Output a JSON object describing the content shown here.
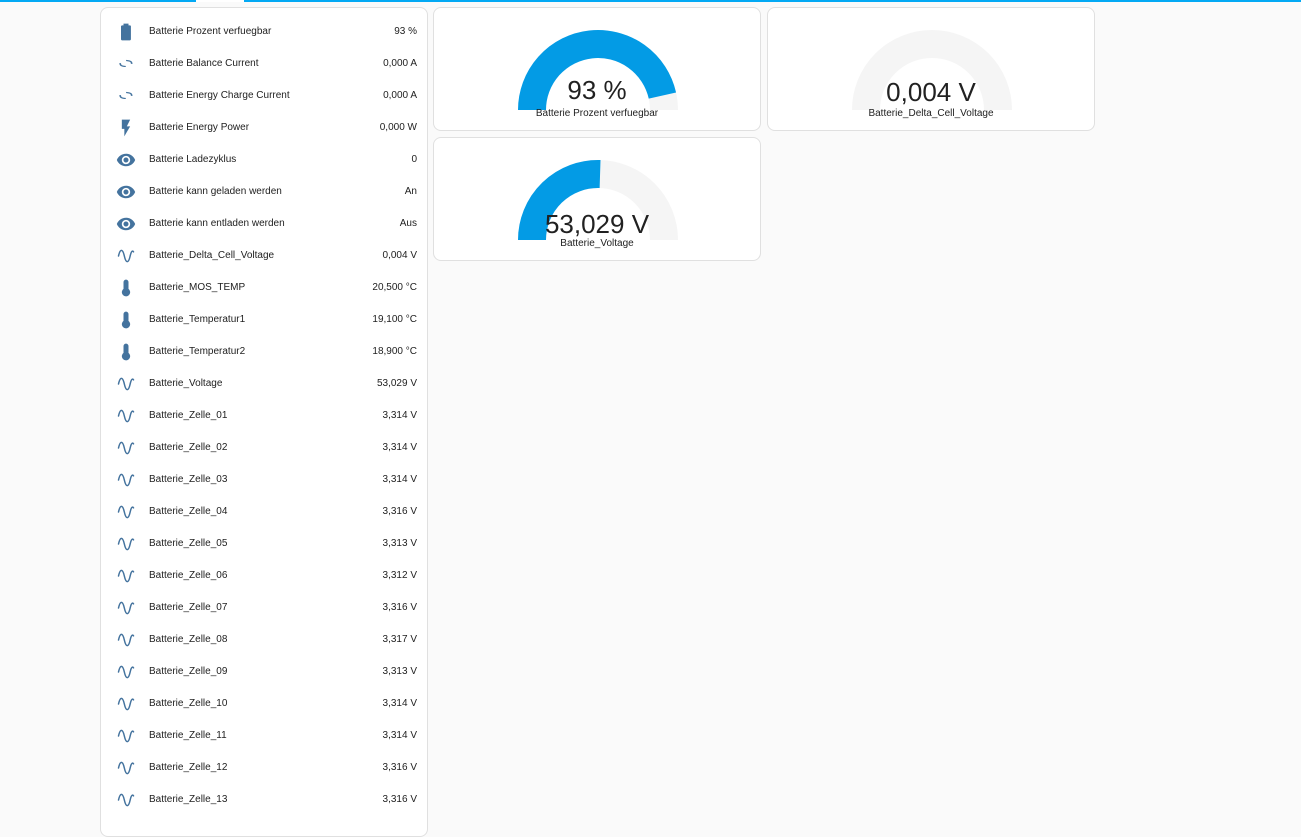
{
  "colors": {
    "accent": "#039be5",
    "gauge_track": "#f5f5f5",
    "icon": "#44739e",
    "topbar": "#03a9f4"
  },
  "entities": [
    {
      "icon": "battery-icon",
      "name": "Batterie Prozent verfuegbar",
      "value": "93 %"
    },
    {
      "icon": "current-ac-icon",
      "name": "Batterie Balance Current",
      "value": "0,000 A"
    },
    {
      "icon": "current-ac-icon",
      "name": "Batterie Energy Charge Current",
      "value": "0,000 A"
    },
    {
      "icon": "flash-icon",
      "name": "Batterie Energy Power",
      "value": "0,000 W"
    },
    {
      "icon": "eye-icon",
      "name": "Batterie Ladezyklus",
      "value": "0"
    },
    {
      "icon": "eye-icon",
      "name": "Batterie kann geladen werden",
      "value": "An"
    },
    {
      "icon": "eye-icon",
      "name": "Batterie kann entladen werden",
      "value": "Aus"
    },
    {
      "icon": "sine-wave-icon",
      "name": "Batterie_Delta_Cell_Voltage",
      "value": "0,004 V"
    },
    {
      "icon": "thermometer-icon",
      "name": "Batterie_MOS_TEMP",
      "value": "20,500 °C"
    },
    {
      "icon": "thermometer-icon",
      "name": "Batterie_Temperatur1",
      "value": "19,100 °C"
    },
    {
      "icon": "thermometer-icon",
      "name": "Batterie_Temperatur2",
      "value": "18,900 °C"
    },
    {
      "icon": "sine-wave-icon",
      "name": "Batterie_Voltage",
      "value": "53,029 V"
    },
    {
      "icon": "sine-wave-icon",
      "name": "Batterie_Zelle_01",
      "value": "3,314 V"
    },
    {
      "icon": "sine-wave-icon",
      "name": "Batterie_Zelle_02",
      "value": "3,314 V"
    },
    {
      "icon": "sine-wave-icon",
      "name": "Batterie_Zelle_03",
      "value": "3,314 V"
    },
    {
      "icon": "sine-wave-icon",
      "name": "Batterie_Zelle_04",
      "value": "3,316 V"
    },
    {
      "icon": "sine-wave-icon",
      "name": "Batterie_Zelle_05",
      "value": "3,313 V"
    },
    {
      "icon": "sine-wave-icon",
      "name": "Batterie_Zelle_06",
      "value": "3,312 V"
    },
    {
      "icon": "sine-wave-icon",
      "name": "Batterie_Zelle_07",
      "value": "3,316 V"
    },
    {
      "icon": "sine-wave-icon",
      "name": "Batterie_Zelle_08",
      "value": "3,317 V"
    },
    {
      "icon": "sine-wave-icon",
      "name": "Batterie_Zelle_09",
      "value": "3,313 V"
    },
    {
      "icon": "sine-wave-icon",
      "name": "Batterie_Zelle_10",
      "value": "3,314 V"
    },
    {
      "icon": "sine-wave-icon",
      "name": "Batterie_Zelle_11",
      "value": "3,314 V"
    },
    {
      "icon": "sine-wave-icon",
      "name": "Batterie_Zelle_12",
      "value": "3,316 V"
    },
    {
      "icon": "sine-wave-icon",
      "name": "Batterie_Zelle_13",
      "value": "3,316 V"
    }
  ],
  "gauges": [
    {
      "value_text": "93 %",
      "name": "Batterie Prozent verfuegbar",
      "fill_fraction": 0.93
    },
    {
      "value_text": "0,004 V",
      "name": "Batterie_Delta_Cell_Voltage",
      "fill_fraction": 0.0
    },
    {
      "value_text": "53,029 V",
      "name": "Batterie_Voltage",
      "fill_fraction": 0.51
    }
  ]
}
